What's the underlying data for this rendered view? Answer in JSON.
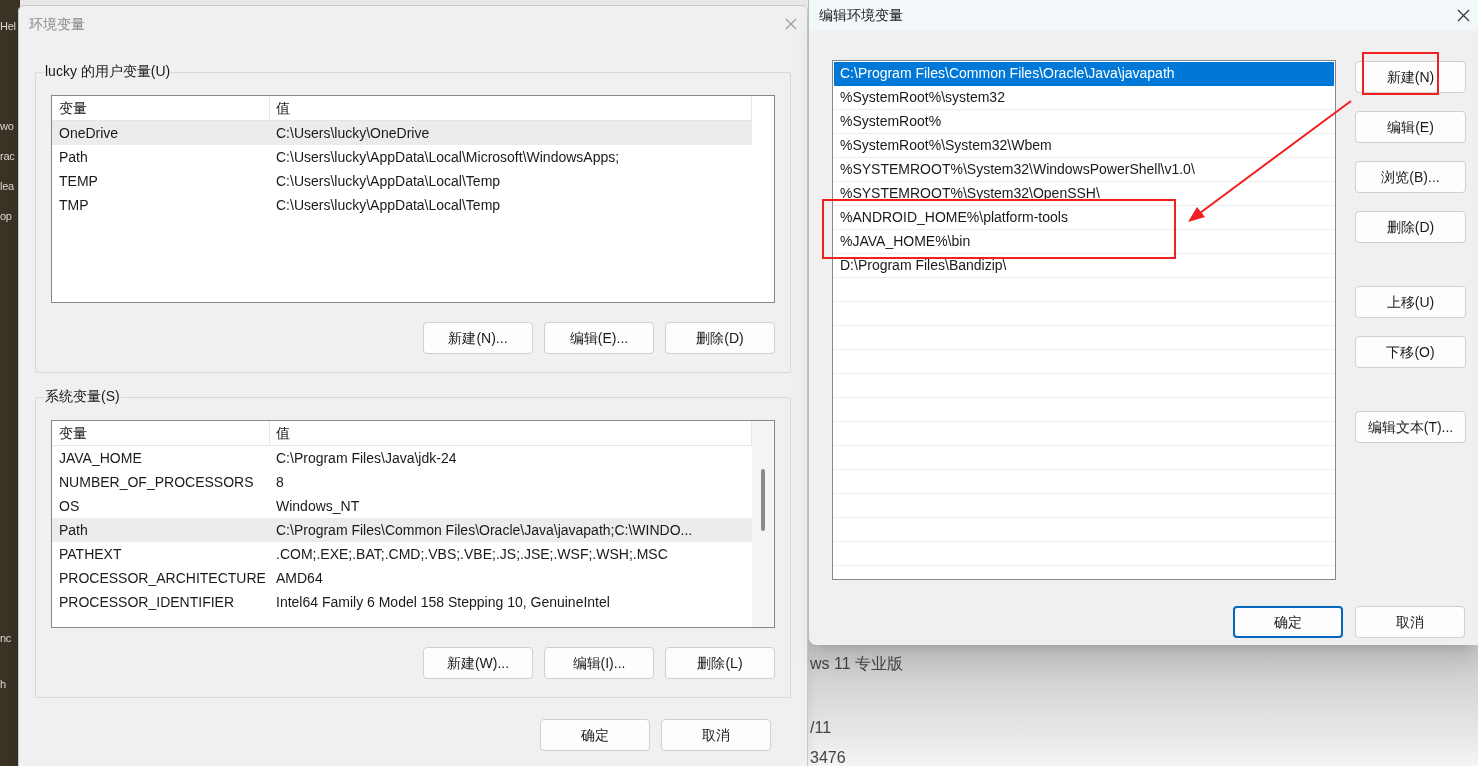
{
  "background": {
    "side_texts": [
      "Hel",
      "wo",
      "rac",
      "lea",
      "op",
      "nc",
      "h"
    ],
    "window_texts": [
      "ws 11 专业版",
      "/11",
      "3476"
    ]
  },
  "env_dialog": {
    "title": "环境变量",
    "groups": [
      {
        "label": "lucky 的用户变量(U)",
        "columns": [
          "变量",
          "值"
        ],
        "rows": [
          {
            "name": "OneDrive",
            "value": "C:\\Users\\lucky\\OneDrive",
            "selected": true
          },
          {
            "name": "Path",
            "value": "C:\\Users\\lucky\\AppData\\Local\\Microsoft\\WindowsApps;",
            "selected": false
          },
          {
            "name": "TEMP",
            "value": "C:\\Users\\lucky\\AppData\\Local\\Temp",
            "selected": false
          },
          {
            "name": "TMP",
            "value": "C:\\Users\\lucky\\AppData\\Local\\Temp",
            "selected": false
          }
        ],
        "buttons": [
          "新建(N)...",
          "编辑(E)...",
          "删除(D)"
        ]
      },
      {
        "label": "系统变量(S)",
        "columns": [
          "变量",
          "值"
        ],
        "rows": [
          {
            "name": "JAVA_HOME",
            "value": "C:\\Program Files\\Java\\jdk-24",
            "selected": false
          },
          {
            "name": "NUMBER_OF_PROCESSORS",
            "value": "8",
            "selected": false
          },
          {
            "name": "OS",
            "value": "Windows_NT",
            "selected": false
          },
          {
            "name": "Path",
            "value": "C:\\Program Files\\Common Files\\Oracle\\Java\\javapath;C:\\WINDO...",
            "selected": true
          },
          {
            "name": "PATHEXT",
            "value": ".COM;.EXE;.BAT;.CMD;.VBS;.VBE;.JS;.JSE;.WSF;.WSH;.MSC",
            "selected": false
          },
          {
            "name": "PROCESSOR_ARCHITECTURE",
            "value": "AMD64",
            "selected": false
          },
          {
            "name": "PROCESSOR_IDENTIFIER",
            "value": "Intel64 Family 6 Model 158 Stepping 10, GenuineIntel",
            "selected": false
          }
        ],
        "buttons": [
          "新建(W)...",
          "编辑(I)...",
          "删除(L)"
        ]
      }
    ],
    "buttons": [
      "确定",
      "取消"
    ]
  },
  "edit_dialog": {
    "title": "编辑环境变量",
    "entries": [
      {
        "text": "C:\\Program Files\\Common Files\\Oracle\\Java\\javapath",
        "selected": true,
        "marked": false
      },
      {
        "text": "%SystemRoot%\\system32",
        "selected": false,
        "marked": false
      },
      {
        "text": "%SystemRoot%",
        "selected": false,
        "marked": false
      },
      {
        "text": "%SystemRoot%\\System32\\Wbem",
        "selected": false,
        "marked": false
      },
      {
        "text": "%SYSTEMROOT%\\System32\\WindowsPowerShell\\v1.0\\",
        "selected": false,
        "marked": false
      },
      {
        "text": "%SYSTEMROOT%\\System32\\OpenSSH\\",
        "selected": false,
        "marked": false
      },
      {
        "text": "%ANDROID_HOME%\\platform-tools",
        "selected": false,
        "marked": true
      },
      {
        "text": "%JAVA_HOME%\\bin",
        "selected": false,
        "marked": true
      },
      {
        "text": "D:\\Program Files\\Bandizip\\",
        "selected": false,
        "marked": false
      }
    ],
    "buttons": [
      {
        "label": "新建(N)",
        "marked": true
      },
      {
        "label": "编辑(E)",
        "marked": false
      },
      {
        "label": "浏览(B)...",
        "marked": false
      },
      {
        "label": "删除(D)",
        "marked": false
      },
      {
        "label": "上移(U)",
        "marked": false
      },
      {
        "label": "下移(O)",
        "marked": false
      },
      {
        "label": "编辑文本(T)...",
        "marked": false
      }
    ],
    "footer_buttons": [
      {
        "label": "确定",
        "default": true
      },
      {
        "label": "取消",
        "default": false
      }
    ]
  }
}
